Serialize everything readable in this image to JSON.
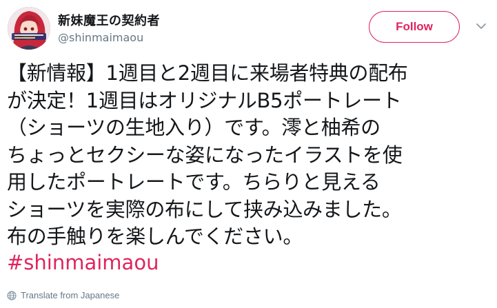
{
  "header": {
    "display_name": "新妹魔王の契約者",
    "handle": "@shinmaimaou",
    "follow_label": "Follow",
    "more_icon": "chevron-down-icon",
    "accent_color": "#e0245e"
  },
  "tweet": {
    "text_lines": [
      "【新情報】1週目と2週目に来場者特典の配布",
      "が決定！1週目はオリジナルB5ポートレート",
      "（ショーツの生地入り）です。澪と柚希の",
      "ちょっとセクシーな姿になったイラストを使",
      "用したポートレートです。ちらりと見える",
      "ショーツを実際の布にして挟み込みました。",
      "布の手触りを楽しんでください。"
    ],
    "hashtag": "#shinmaimaou"
  },
  "footer": {
    "translate_label": "Translate from Japanese",
    "translate_icon": "globe-icon"
  }
}
